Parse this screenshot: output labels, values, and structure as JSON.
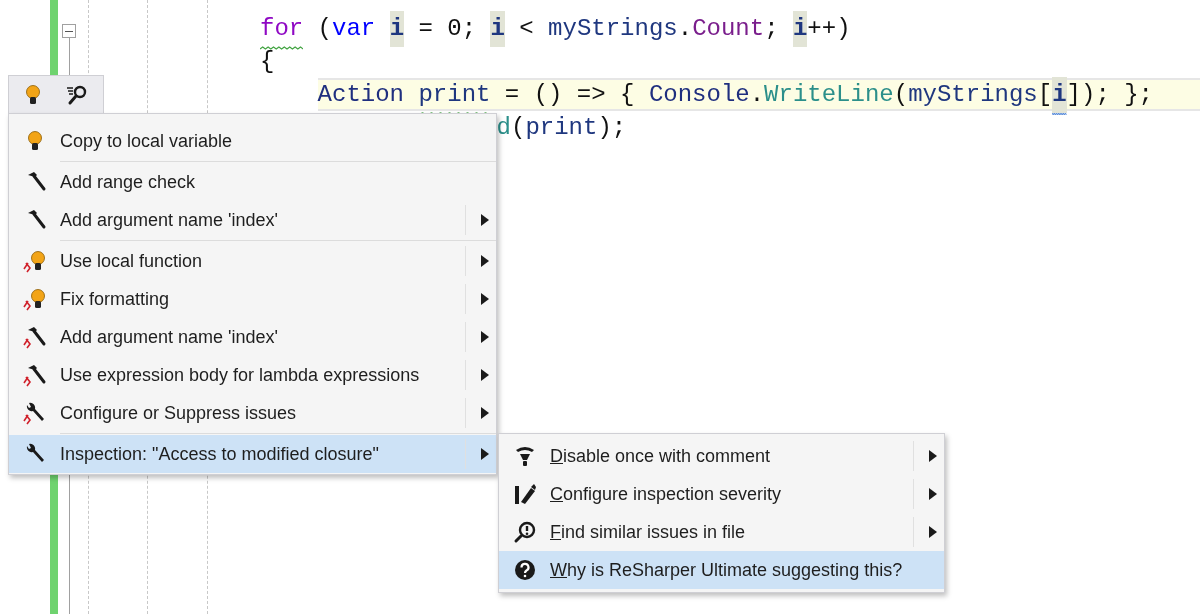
{
  "editor": {
    "code_lines": [
      {
        "current_line": false,
        "partial": false,
        "tokens": [
          {
            "text": "for",
            "kind": "control",
            "highlighted": false,
            "warning": true,
            "hint": false
          },
          {
            "text": " (",
            "kind": "punct",
            "highlighted": false,
            "warning": false,
            "hint": false
          },
          {
            "text": "var ",
            "kind": "keyword",
            "highlighted": false,
            "warning": false,
            "hint": false
          },
          {
            "text": "i",
            "kind": "local",
            "highlighted": true,
            "warning": false,
            "hint": false
          },
          {
            "text": " = 0; ",
            "kind": "punct",
            "highlighted": false,
            "warning": false,
            "hint": false
          },
          {
            "text": "i",
            "kind": "local",
            "highlighted": true,
            "warning": false,
            "hint": false
          },
          {
            "text": " < ",
            "kind": "punct",
            "highlighted": false,
            "warning": false,
            "hint": false
          },
          {
            "text": "myStrings",
            "kind": "ident",
            "highlighted": false,
            "warning": false,
            "hint": false
          },
          {
            "text": ".",
            "kind": "punct",
            "highlighted": false,
            "warning": false,
            "hint": false
          },
          {
            "text": "Count",
            "kind": "property",
            "highlighted": false,
            "warning": false,
            "hint": false
          },
          {
            "text": "; ",
            "kind": "punct",
            "highlighted": false,
            "warning": false,
            "hint": false
          },
          {
            "text": "i",
            "kind": "local",
            "highlighted": true,
            "warning": false,
            "hint": false
          },
          {
            "text": "++)",
            "kind": "punct",
            "highlighted": false,
            "warning": false,
            "hint": false
          }
        ]
      },
      {
        "current_line": false,
        "partial": false,
        "tokens": [
          {
            "text": "{",
            "kind": "punct",
            "highlighted": false,
            "warning": false,
            "hint": false
          }
        ],
        "children": [
          {
            "current_line": true,
            "partial": false,
            "tokens": [
              {
                "text": "Action ",
                "kind": "type",
                "highlighted": false,
                "warning": false,
                "hint": false
              },
              {
                "text": "print",
                "kind": "ident",
                "highlighted": false,
                "warning": true,
                "hint": false
              },
              {
                "text": " = () => { ",
                "kind": "punct",
                "highlighted": false,
                "warning": false,
                "hint": false
              },
              {
                "text": "Console",
                "kind": "type",
                "highlighted": false,
                "warning": false,
                "hint": false
              },
              {
                "text": ".",
                "kind": "punct",
                "highlighted": false,
                "warning": false,
                "hint": false
              },
              {
                "text": "WriteLine",
                "kind": "method",
                "highlighted": false,
                "warning": false,
                "hint": false
              },
              {
                "text": "(",
                "kind": "punct",
                "highlighted": false,
                "warning": false,
                "hint": false
              },
              {
                "text": "myStrings",
                "kind": "ident",
                "highlighted": false,
                "warning": false,
                "hint": false
              },
              {
                "text": "[",
                "kind": "punct",
                "highlighted": false,
                "warning": false,
                "hint": false
              },
              {
                "text": "i",
                "kind": "local",
                "highlighted": true,
                "warning": false,
                "hint": true
              },
              {
                "text": "]); };",
                "kind": "punct",
                "highlighted": false,
                "warning": false,
                "hint": false
              }
            ]
          },
          {
            "current_line": false,
            "partial": true,
            "tokens": [
              {
                "text": "d",
                "kind": "method",
                "highlighted": false,
                "warning": false,
                "hint": false
              },
              {
                "text": "(",
                "kind": "punct",
                "highlighted": false,
                "warning": false,
                "hint": false
              },
              {
                "text": "print",
                "kind": "ident",
                "highlighted": false,
                "warning": false,
                "hint": false
              },
              {
                "text": ");",
                "kind": "punct",
                "highlighted": false,
                "warning": false,
                "hint": false
              }
            ]
          }
        ]
      }
    ]
  },
  "action_bar": [
    {
      "kind": "bulb"
    },
    {
      "kind": "find-list"
    }
  ],
  "menu": {
    "groups": [
      [
        {
          "label": "Copy to local variable",
          "kind": "bulb",
          "has_submenu": false,
          "selected": false
        }
      ],
      [
        {
          "label": "Add range check",
          "kind": "hammer",
          "has_submenu": false,
          "selected": false
        },
        {
          "label": "Add argument name 'index'",
          "kind": "hammer",
          "has_submenu": true,
          "selected": false
        }
      ],
      [
        {
          "label": "Use local function",
          "kind": "bulb-fix",
          "has_submenu": true,
          "selected": false
        },
        {
          "label": "Fix formatting",
          "kind": "bulb-fix",
          "has_submenu": true,
          "selected": false
        },
        {
          "label": "Add argument name 'index'",
          "kind": "hammer-fix",
          "has_submenu": true,
          "selected": false
        },
        {
          "label": "Use expression body for lambda expressions",
          "kind": "hammer-fix",
          "has_submenu": true,
          "selected": false
        },
        {
          "label": "Configure or Suppress issues",
          "kind": "wrench-fix",
          "has_submenu": true,
          "selected": false
        }
      ],
      [
        {
          "label": "Inspection: \"Access to modified closure\"",
          "kind": "wrench",
          "has_submenu": true,
          "selected": true
        }
      ]
    ]
  },
  "submenu": {
    "items": [
      {
        "label": "Disable once with comment",
        "kind": "disable",
        "has_submenu": true,
        "selected": false,
        "underline_first": true
      },
      {
        "label": "Configure inspection severity",
        "kind": "severity",
        "has_submenu": true,
        "selected": false,
        "underline_first": true
      },
      {
        "label": "Find similar issues in file",
        "kind": "find",
        "has_submenu": true,
        "selected": false,
        "underline_first": true
      },
      {
        "label": "Why is ReSharper Ultimate suggesting this?",
        "kind": "help",
        "has_submenu": false,
        "selected": true,
        "underline_first": true
      }
    ]
  }
}
